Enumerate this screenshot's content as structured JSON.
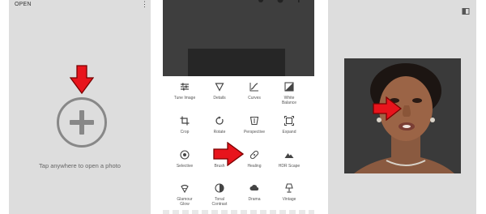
{
  "left_panel": {
    "title": "OPEN",
    "menu_icon": "more-vert-icon",
    "add_icon": "add-circle-icon",
    "hint": "Tap anywhere to open a photo"
  },
  "tools": [
    {
      "label": "Tune Image",
      "icon": "tune-icon"
    },
    {
      "label": "Details",
      "icon": "triangle-details-icon"
    },
    {
      "label": "Curves",
      "icon": "curves-icon"
    },
    {
      "label": "White\nBalance",
      "icon": "white-balance-icon"
    },
    {
      "label": "Crop",
      "icon": "crop-icon"
    },
    {
      "label": "Rotate",
      "icon": "rotate-icon"
    },
    {
      "label": "Perspective",
      "icon": "perspective-icon"
    },
    {
      "label": "Expand",
      "icon": "expand-icon"
    },
    {
      "label": "Selective",
      "icon": "selective-icon"
    },
    {
      "label": "Brush",
      "icon": "brush-icon"
    },
    {
      "label": "Healing",
      "icon": "healing-bandage-icon"
    },
    {
      "label": "HDR Scape",
      "icon": "mountain-icon"
    },
    {
      "label": "Glamour\nGlow",
      "icon": "glamour-glow-icon"
    },
    {
      "label": "Tonal\nContrast",
      "icon": "tonal-contrast-icon"
    },
    {
      "label": "Drama",
      "icon": "cloud-icon"
    },
    {
      "label": "Vintage",
      "icon": "lamp-icon"
    }
  ],
  "right_panel": {
    "compare_icon": "compare-icon"
  },
  "colors": {
    "panel_bg": "#dddddd",
    "arrow_red": "#e8141c",
    "icon_gray": "#888888",
    "preview_dark": "#3e3e3e"
  }
}
